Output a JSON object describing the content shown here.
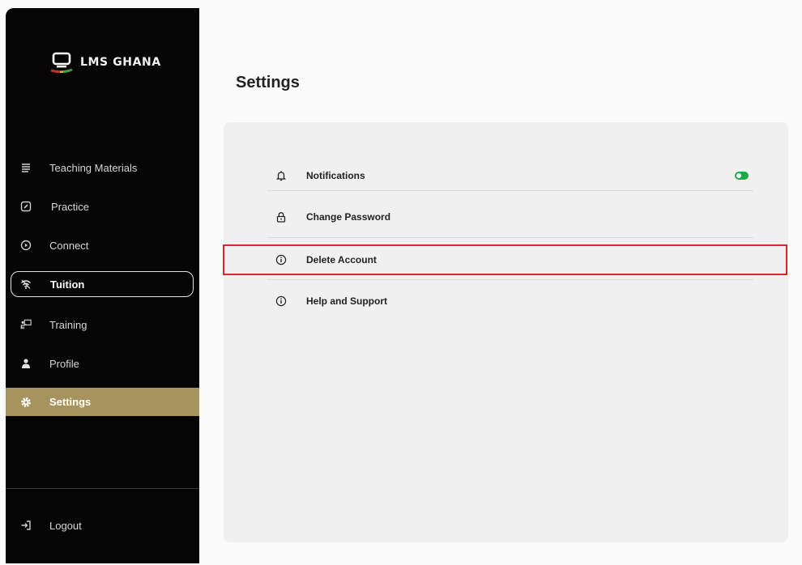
{
  "sidebar": {
    "brand": "LMS GHANA",
    "items": [
      {
        "label": "Teaching Materials",
        "icon": "book-stack-icon"
      },
      {
        "label": "Practice",
        "icon": "pencil-square-icon"
      },
      {
        "label": "Connect",
        "icon": "play-circle-icon"
      },
      {
        "label": "Tuition",
        "icon": "wifi-icon"
      },
      {
        "label": "Training",
        "icon": "presenter-icon"
      },
      {
        "label": "Profile",
        "icon": "user-icon"
      },
      {
        "label": "Settings",
        "icon": "gear-icon"
      }
    ],
    "logout": {
      "label": "Logout",
      "icon": "logout-icon"
    }
  },
  "main": {
    "title": "Settings",
    "settings": [
      {
        "label": "Notifications",
        "icon": "bell-icon",
        "toggle_on": true
      },
      {
        "label": "Change Password",
        "icon": "lock-icon"
      },
      {
        "label": "Delete Account",
        "icon": "info-icon",
        "highlighted": true
      },
      {
        "label": "Help and Support",
        "icon": "info-icon"
      }
    ]
  },
  "colors": {
    "sidebar_bg": "#050505",
    "active_item": "#a7935d",
    "toggle_on": "#1fa84a",
    "highlight_border": "#d42a2a"
  }
}
